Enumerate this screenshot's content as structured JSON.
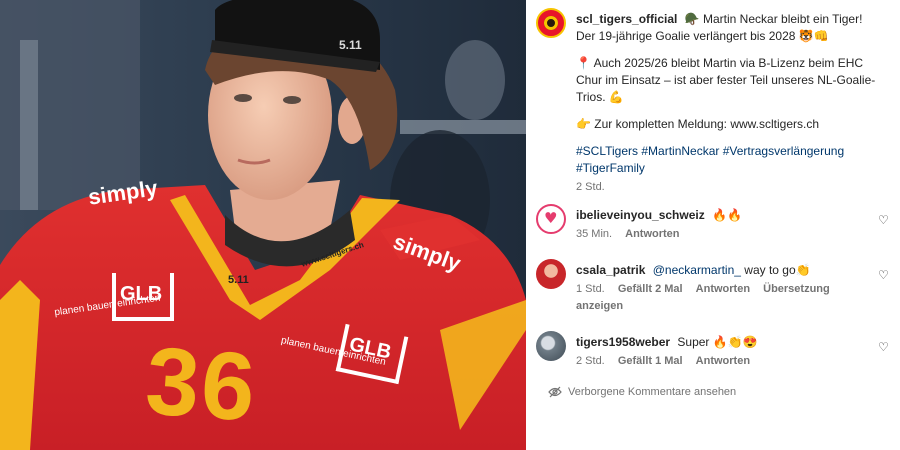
{
  "post": {
    "username": "scl_tigers_official",
    "caption_line1": "🪖 Martin Neckar bleibt ein Tiger! Der 19-jährige Goalie verlängert bis 2028 🐯👊",
    "caption_line2": "📍 Auch 2025/26 bleibt Martin via B-Lizenz beim EHC Chur im Einsatz – ist aber fester Teil unseres NL-Goalie-Trios. 💪",
    "caption_line3": "👉 Zur kompletten Meldung: www.scltigers.ch",
    "hashtags": "#SCLTigers #MartinNeckar #Vertragsverlängerung #TigerFamily",
    "time": "2 Std."
  },
  "comments": [
    {
      "username": "ibelieveinyou_schweiz",
      "text": "🔥🔥",
      "time": "35 Min.",
      "reply": "Antworten"
    },
    {
      "username": "csala_patrik",
      "mention": "@neckarmartin_",
      "text": " way to go👏",
      "time": "1 Std.",
      "likes": "Gefällt 2 Mal",
      "reply": "Antworten",
      "translate": "Übersetzung anzeigen"
    },
    {
      "username": "tigers1958weber",
      "text": "Super 🔥👏😍",
      "time": "2 Std.",
      "likes": "Gefällt 1 Mal",
      "reply": "Antworten"
    }
  ],
  "hidden_comments_label": "Verborgene Kommentare ansehen",
  "photo": {
    "jersey_brand": "simply",
    "jersey_sponsor": "GLB",
    "sponsor_tagline": "planen bauen einrichten",
    "jersey_number": "36",
    "cap_logo": "5.11",
    "collar_text": "www.scltigers.ch"
  },
  "colors": {
    "jersey_red": "#d3242a",
    "jersey_yellow": "#f3b51c",
    "link_blue": "#00376b",
    "muted": "#737373"
  }
}
